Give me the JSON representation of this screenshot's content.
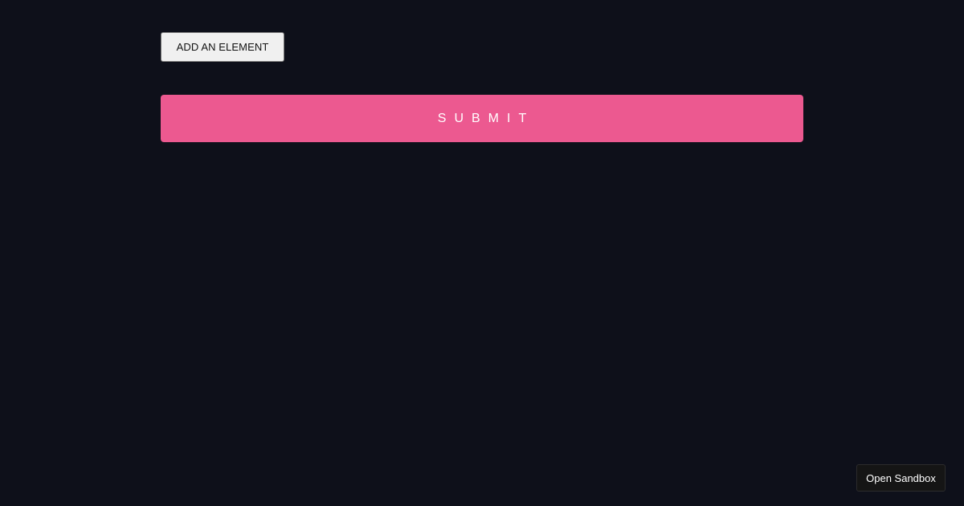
{
  "form": {
    "add_element_label": "ADD AN ELEMENT",
    "submit_label": "SUBMIT"
  },
  "footer": {
    "sandbox_label": "Open Sandbox"
  },
  "colors": {
    "background": "#0e101a",
    "submit_accent": "#ec5990",
    "add_button_bg": "#f0f0f0",
    "sandbox_bg": "#151515"
  }
}
